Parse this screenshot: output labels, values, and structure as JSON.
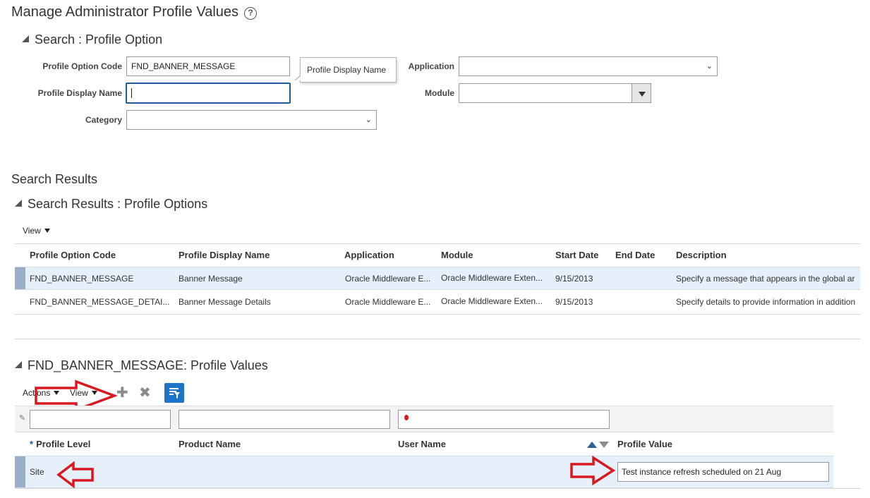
{
  "page": {
    "title": "Manage Administrator Profile Values"
  },
  "search": {
    "header": "Search : Profile Option",
    "fields": {
      "profile_option_code": {
        "label": "Profile Option Code",
        "value": "FND_BANNER_MESSAGE"
      },
      "profile_display_name": {
        "label": "Profile Display Name",
        "value": ""
      },
      "category": {
        "label": "Category",
        "value": ""
      },
      "application": {
        "label": "Application",
        "value": ""
      },
      "module": {
        "label": "Module",
        "value": ""
      }
    },
    "tooltip": "Profile Display Name"
  },
  "results": {
    "title": "Search Results",
    "header": "Search Results : Profile Options",
    "view_label": "View",
    "columns": [
      "Profile Option Code",
      "Profile Display Name",
      "Application",
      "Module",
      "Start Date",
      "End Date",
      "Description"
    ],
    "rows": [
      [
        "FND_BANNER_MESSAGE",
        "Banner Message",
        "Oracle Middleware E...",
        "Oracle Middleware Exten...",
        "9/15/2013",
        "",
        "Specify a message that appears in the global ar"
      ],
      [
        "FND_BANNER_MESSAGE_DETAI...",
        "Banner Message Details",
        "Oracle Middleware E...",
        "Oracle Middleware Exten...",
        "9/15/2013",
        "",
        "Specify details to provide information in addition"
      ]
    ]
  },
  "values": {
    "header": "FND_BANNER_MESSAGE: Profile Values",
    "actions_label": "Actions",
    "view_label": "View",
    "columns": {
      "profile_level": "Profile Level",
      "product_name": "Product Name",
      "user_name": "User Name",
      "profile_value": "Profile Value"
    },
    "rows": [
      {
        "profile_level": "Site",
        "profile_value": "Test instance refresh scheduled on 21 Aug"
      }
    ]
  },
  "colors": {
    "accent": "#1f5aa6",
    "selected_row": "#e6f0fb",
    "arrow_red": "#d9191f"
  }
}
